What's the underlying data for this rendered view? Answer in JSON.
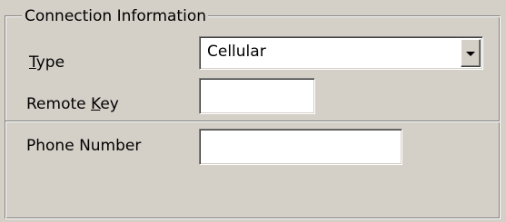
{
  "group": {
    "title": "Connection Information"
  },
  "type_field": {
    "label_mnemonic": "T",
    "label_rest": "ype",
    "value": "Cellular"
  },
  "remote_key_field": {
    "label_before": "Remote ",
    "label_mnemonic": "K",
    "label_after": "ey",
    "value": ""
  },
  "phone_number_field": {
    "label": "Phone Number",
    "value": ""
  },
  "icons": {
    "combo_arrow": "chevron-down-icon"
  }
}
